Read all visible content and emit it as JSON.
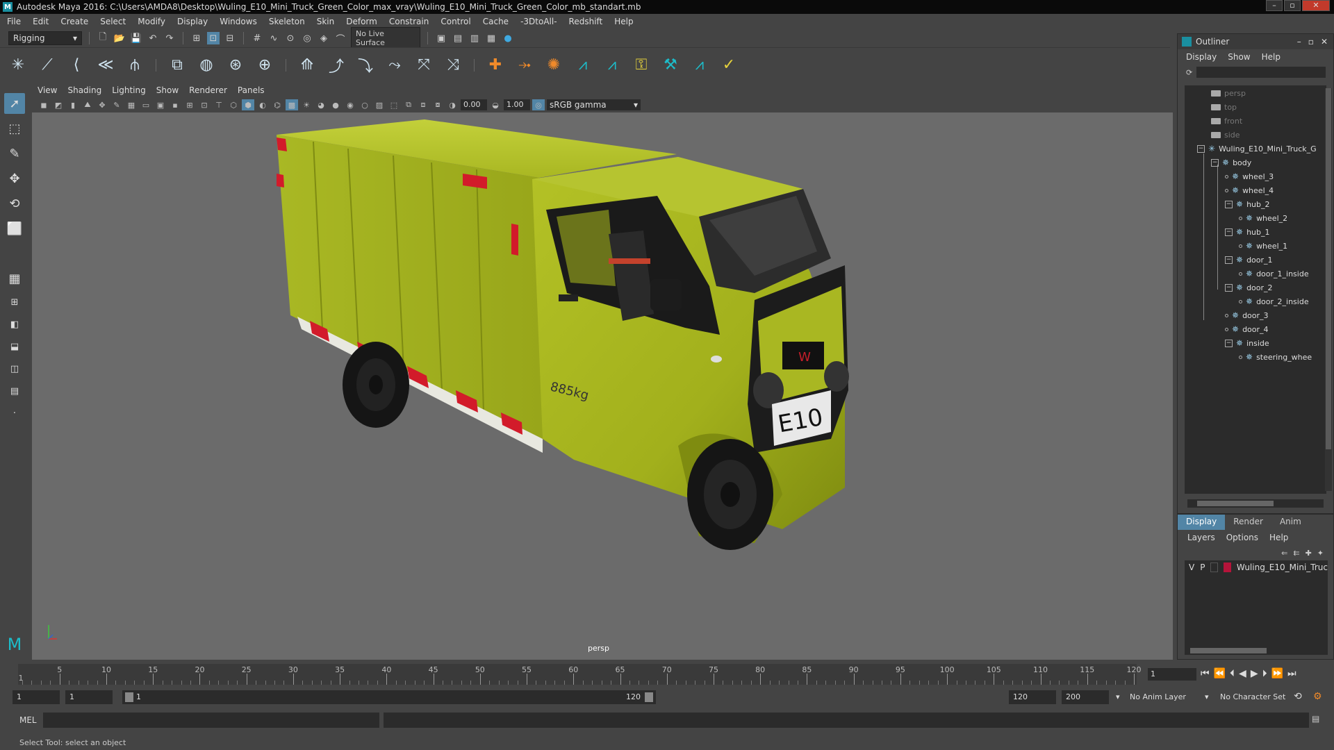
{
  "window": {
    "title": "Autodesk Maya 2016: C:\\Users\\AMDA8\\Desktop\\Wuling_E10_Mini_Truck_Green_Color_max_vray\\Wuling_E10_Mini_Truck_Green_Color_mb_standart.mb"
  },
  "menubar": [
    "File",
    "Edit",
    "Create",
    "Select",
    "Modify",
    "Display",
    "Windows",
    "Skeleton",
    "Skin",
    "Deform",
    "Constrain",
    "Control",
    "Cache",
    "-3DtoAll-",
    "Redshift",
    "Help"
  ],
  "statusline": {
    "menuset": "Rigging",
    "live_surface": "No Live Surface"
  },
  "viewport": {
    "menu": [
      "View",
      "Shading",
      "Lighting",
      "Show",
      "Renderer",
      "Panels"
    ],
    "exposure": "0.00",
    "gamma_value": "1.00",
    "color_space": "sRGB gamma",
    "camera_label": "persp",
    "model": {
      "payload_label": "885kg",
      "plate": "E10",
      "body_color": "#a6b51c"
    }
  },
  "outliner": {
    "title": "Outliner",
    "menu": [
      "Display",
      "Show",
      "Help"
    ],
    "items": [
      {
        "label": "persp"
      },
      {
        "label": "top"
      },
      {
        "label": "front"
      },
      {
        "label": "side"
      },
      {
        "label": "Wuling_E10_Mini_Truck_G"
      },
      {
        "label": "body"
      },
      {
        "label": "wheel_3"
      },
      {
        "label": "wheel_4"
      },
      {
        "label": "hub_2"
      },
      {
        "label": "wheel_2"
      },
      {
        "label": "hub_1"
      },
      {
        "label": "wheel_1"
      },
      {
        "label": "door_1"
      },
      {
        "label": "door_1_inside"
      },
      {
        "label": "door_2"
      },
      {
        "label": "door_2_inside"
      },
      {
        "label": "door_3"
      },
      {
        "label": "door_4"
      },
      {
        "label": "inside"
      },
      {
        "label": "steering_whee"
      }
    ]
  },
  "layers": {
    "tabs": [
      "Display",
      "Render",
      "Anim"
    ],
    "menu": [
      "Layers",
      "Options",
      "Help"
    ],
    "layer": {
      "v": "V",
      "p": "P",
      "name": "Wuling_E10_Mini_Truc",
      "color": "#b5143a"
    }
  },
  "timeline": {
    "ticks": [
      "5",
      "10",
      "15",
      "20",
      "25",
      "30",
      "35",
      "40",
      "45",
      "50",
      "55",
      "60",
      "65",
      "70",
      "75",
      "80",
      "85",
      "90",
      "95",
      "100",
      "105",
      "110",
      "115",
      "120"
    ],
    "current_frame_marker": "1",
    "current_frame": "1"
  },
  "range": {
    "start": "1",
    "start_inner": "1",
    "slider_start": "1",
    "slider_end": "120",
    "end": "120",
    "end_outer": "200",
    "anim_layer": "No Anim Layer",
    "char_set": "No Character Set"
  },
  "cmdline": {
    "lang": "MEL"
  },
  "helpline": {
    "text": "Select Tool: select an object"
  }
}
